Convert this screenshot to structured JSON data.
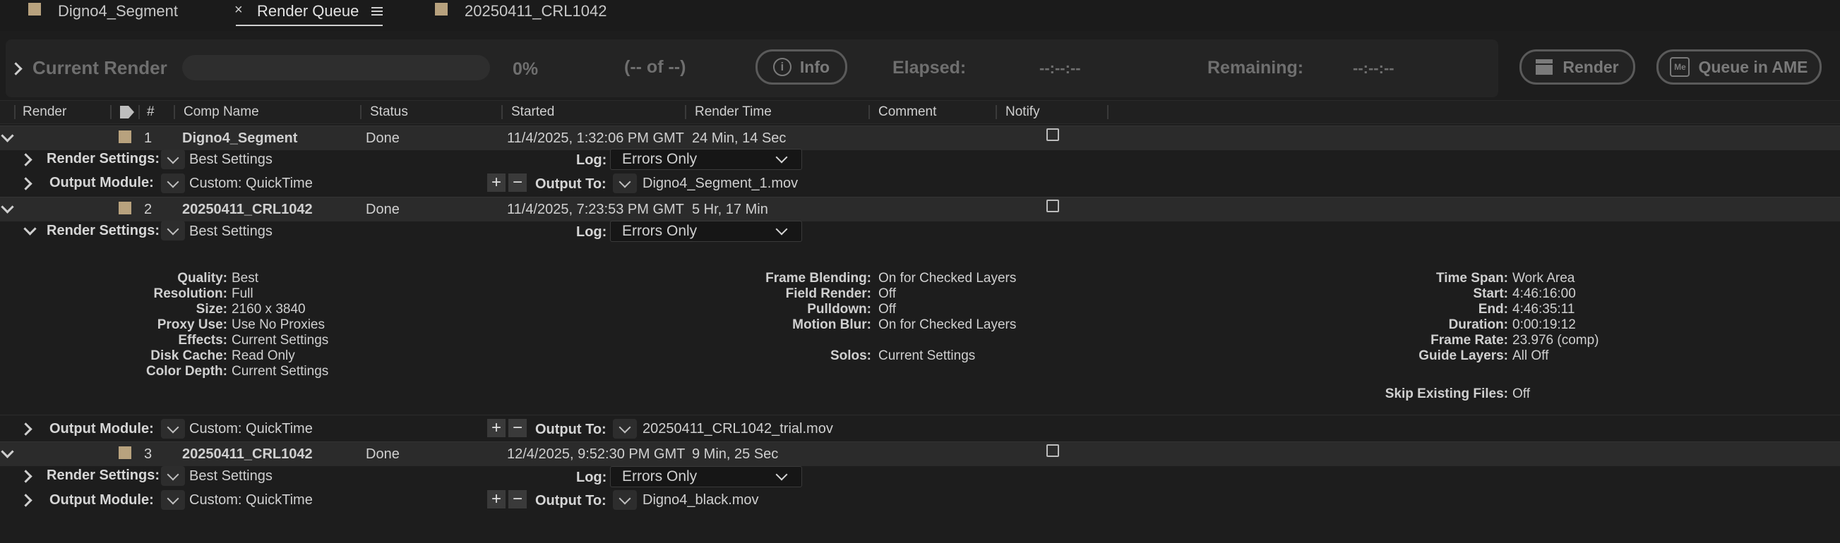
{
  "tabs": [
    {
      "label": "Digno4_Segment"
    },
    {
      "label": "Render Queue",
      "close": "×"
    },
    {
      "label": "20250411_CRL1042"
    }
  ],
  "current_render": {
    "label": "Current Render",
    "percent": "0%",
    "progress_fraction": 0,
    "count": "(-- of --)",
    "info_label": "Info",
    "elapsed_label": "Elapsed:",
    "elapsed_value": "--:--:--",
    "remaining_label": "Remaining:",
    "remaining_value": "--:--:--",
    "render_label": "Render",
    "queue_ame_label": "Queue in AME",
    "ame_icon_text": "Me"
  },
  "columns": {
    "render": "Render",
    "num": "#",
    "comp_name": "Comp Name",
    "status": "Status",
    "started": "Started",
    "render_time": "Render Time",
    "comment": "Comment",
    "notify": "Notify"
  },
  "labels": {
    "render_settings": "Render Settings:",
    "output_module": "Output Module:",
    "log": "Log:",
    "output_to": "Output To:",
    "plus": "+",
    "minus": "−"
  },
  "items": [
    {
      "num": "1",
      "comp_name": "Digno4_Segment",
      "status": "Done",
      "started": "11/4/2025, 1:32:06 PM GMT",
      "render_time": "24 Min, 14 Sec",
      "render_settings": "Best Settings",
      "log": "Errors Only",
      "output_module": "Custom: QuickTime",
      "output_to": "Digno4_Segment_1.mov"
    },
    {
      "num": "2",
      "comp_name": "20250411_CRL1042",
      "status": "Done",
      "started": "11/4/2025, 7:23:53 PM GMT",
      "render_time": "5 Hr, 17 Min",
      "render_settings": "Best Settings",
      "log": "Errors Only",
      "output_module": "Custom: QuickTime",
      "output_to": "20250411_CRL1042_trial.mov"
    },
    {
      "num": "3",
      "comp_name": "20250411_CRL1042",
      "status": "Done",
      "started": "12/4/2025, 9:52:30 PM GMT",
      "render_time": "9 Min, 25 Sec",
      "render_settings": "Best Settings",
      "log": "Errors Only",
      "output_module": "Custom: QuickTime",
      "output_to": "Digno4_black.mov"
    }
  ],
  "details": {
    "left": [
      {
        "k": "Quality:",
        "v": "Best"
      },
      {
        "k": "Resolution:",
        "v": "Full"
      },
      {
        "k": "Size:",
        "v": "2160 x 3840"
      },
      {
        "k": "Proxy Use:",
        "v": "Use No Proxies"
      },
      {
        "k": "Effects:",
        "v": "Current Settings"
      },
      {
        "k": "Disk Cache:",
        "v": "Read Only"
      },
      {
        "k": "Color Depth:",
        "v": "Current Settings"
      }
    ],
    "middle": [
      {
        "k": "Frame Blending:",
        "v": "On for Checked Layers"
      },
      {
        "k": "Field Render:",
        "v": "Off"
      },
      {
        "k": "Pulldown:",
        "v": "Off"
      },
      {
        "k": "Motion Blur:",
        "v": "On for Checked Layers"
      },
      {
        "k": "Solos:",
        "v": "Current Settings"
      }
    ],
    "right": [
      {
        "k": "Time Span:",
        "v": "Work Area"
      },
      {
        "k": "Start:",
        "v": "4:46:16:00"
      },
      {
        "k": "End:",
        "v": "4:46:35:11"
      },
      {
        "k": "Duration:",
        "v": "0:00:19:12"
      },
      {
        "k": "Frame Rate:",
        "v": "23.976 (comp)"
      },
      {
        "k": "Guide Layers:",
        "v": "All Off"
      },
      {
        "k": "Skip Existing Files:",
        "v": "Off"
      }
    ]
  },
  "colors": {
    "label_swatch": "#b8a27e",
    "background": "#1d1d1d"
  }
}
